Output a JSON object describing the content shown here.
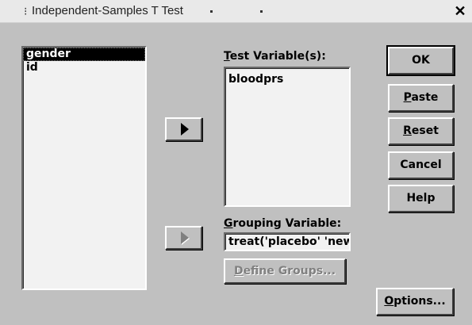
{
  "window": {
    "title": "Independent-Samples T Test",
    "grip": "⁝",
    "close_label": "✕"
  },
  "source_list": {
    "items": [
      {
        "label": "gender",
        "selected": true
      },
      {
        "label": "id",
        "selected": false
      }
    ]
  },
  "test_variables": {
    "label_accel": "T",
    "label_rest": "est Variable(s):",
    "items": [
      {
        "label": "bloodprs",
        "selected": false
      }
    ]
  },
  "grouping": {
    "label_accel": "G",
    "label_rest": "rouping Variable:",
    "value": "treat('placebo' 'new')"
  },
  "buttons": {
    "ok": "OK",
    "paste_accel": "P",
    "paste_rest": "aste",
    "reset_accel": "R",
    "reset_rest": "eset",
    "cancel": "Cancel",
    "help": "Help",
    "define_groups_accel": "D",
    "define_groups_rest": "efine Groups...",
    "options_accel": "O",
    "options_rest": "ptions..."
  },
  "icons": {
    "move_test_arrow": "right-arrow-icon",
    "move_grouping_arrow": "right-arrow-icon"
  }
}
